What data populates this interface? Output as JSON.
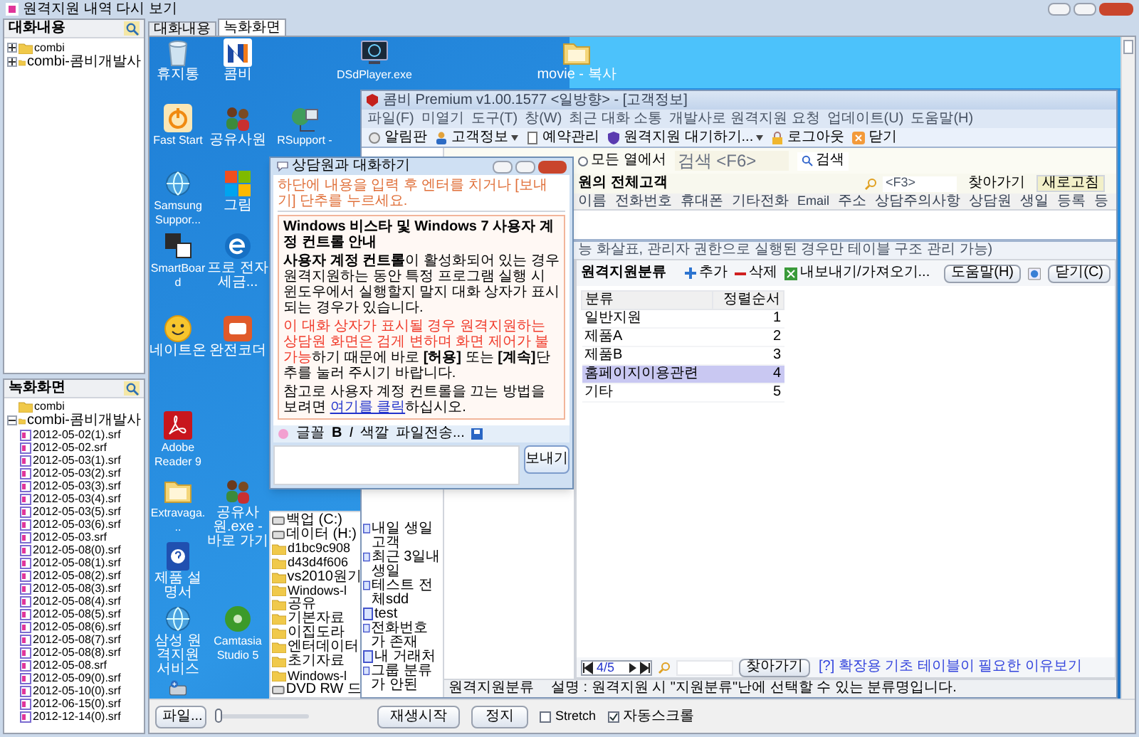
{
  "window": {
    "title": "원격지원 내역 다시 보기"
  },
  "sidebar": {
    "chat_panel": {
      "title": "대화내용",
      "tree": [
        {
          "label": "combi",
          "expanded": false
        },
        {
          "label": "combi-콤비개발사",
          "expanded": false
        }
      ]
    },
    "recording_panel": {
      "title": "녹화화면",
      "tree": [
        {
          "label": "combi"
        },
        {
          "label": "combi-콤비개발사",
          "expanded": true,
          "children": [
            {
              "label": "2012-05-02(1).srf"
            },
            {
              "label": "2012-05-02.srf"
            },
            {
              "label": "2012-05-03(1).srf"
            },
            {
              "label": "2012-05-03(2).srf"
            },
            {
              "label": "2012-05-03(3).srf"
            },
            {
              "label": "2012-05-03(4).srf"
            },
            {
              "label": "2012-05-03(5).srf"
            },
            {
              "label": "2012-05-03(6).srf"
            },
            {
              "label": "2012-05-03.srf"
            },
            {
              "label": "2012-05-08(0).srf"
            },
            {
              "label": "2012-05-08(1).srf"
            },
            {
              "label": "2012-05-08(2).srf"
            },
            {
              "label": "2012-05-08(3).srf"
            },
            {
              "label": "2012-05-08(4).srf"
            },
            {
              "label": "2012-05-08(5).srf"
            },
            {
              "label": "2012-05-08(6).srf"
            },
            {
              "label": "2012-05-08(7).srf"
            },
            {
              "label": "2012-05-08(8).srf"
            },
            {
              "label": "2012-05-08.srf"
            },
            {
              "label": "2012-05-09(0).srf"
            },
            {
              "label": "2012-05-10(0).srf"
            },
            {
              "label": "2012-06-15(0).srf"
            },
            {
              "label": "2012-12-14(0).srf"
            }
          ]
        }
      ]
    }
  },
  "tabs": [
    {
      "label": "대화내용",
      "selected": false
    },
    {
      "label": "녹화화면",
      "selected": true
    }
  ],
  "desktop": {
    "icons": [
      {
        "label": "휴지통",
        "kind": "trash"
      },
      {
        "label": "콤비",
        "kind": "logo"
      },
      {
        "label": "DSdPlayer.exe",
        "kind": "monitor"
      },
      {
        "label": "movie - 복사",
        "kind": "folder"
      },
      {
        "label": "Fast Start",
        "kind": "power"
      },
      {
        "label": "공유사원",
        "kind": "people"
      },
      {
        "label": "RSupport -",
        "kind": "network"
      },
      {
        "label": "Samsung Suppor...",
        "kind": "globe"
      },
      {
        "label": "그림",
        "kind": "tiles"
      },
      {
        "label": "SmartBoard",
        "kind": "board"
      },
      {
        "label": "프로 전자세금...",
        "kind": "browser"
      },
      {
        "label": "네이트온",
        "kind": "chat"
      },
      {
        "label": "완전코더",
        "kind": "app"
      },
      {
        "label": "Adobe Reader 9",
        "kind": "pdf"
      },
      {
        "label": "Extravaga...",
        "kind": "folder"
      },
      {
        "label": "공유사원.exe - 바로 가기",
        "kind": "people"
      },
      {
        "label": "제품 설명서",
        "kind": "help"
      },
      {
        "label": "삼성 원격지원 서비스",
        "kind": "globe"
      },
      {
        "label": "Camtasia Studio 5",
        "kind": "disc"
      },
      {
        "kind": "drive"
      }
    ]
  },
  "explorer": {
    "items": [
      {
        "label": "백업 (C:)",
        "kind": "drive"
      },
      {
        "label": "데이터 (H:)",
        "kind": "drive"
      },
      {
        "label": "d1bc9c908",
        "kind": "folder"
      },
      {
        "label": "d43d4f606",
        "kind": "folder"
      },
      {
        "label": "vs2010원기",
        "kind": "folder"
      },
      {
        "label": "Windows-l",
        "kind": "folder"
      },
      {
        "label": "공유",
        "kind": "folder"
      },
      {
        "label": "기본자료",
        "kind": "folder"
      },
      {
        "label": "이집도라",
        "kind": "folder"
      },
      {
        "label": "엔터데이터",
        "kind": "folder"
      },
      {
        "label": "초기자료",
        "kind": "folder"
      },
      {
        "label": "Windows-l",
        "kind": "folder"
      },
      {
        "label": "DVD RW 드",
        "kind": "drive"
      }
    ]
  },
  "app_window": {
    "title": "콤비 Premium v1.00.1577 <일방향> - [고객정보]",
    "menu": [
      "파일(F)",
      "미열기",
      "도구(T)",
      "창(W)",
      "최근 대화 소통",
      "개발사로 원격지원 요청",
      "업데이트(U)",
      "도움말(H)"
    ],
    "toolbar": [
      {
        "label": "알림판",
        "kind": "bell",
        "dropdown": false
      },
      {
        "label": "고객정보",
        "kind": "person",
        "dropdown": true
      },
      {
        "label": "예약관리",
        "kind": "note",
        "dropdown": false
      },
      {
        "label": "원격지원 대기하기...",
        "kind": "shield",
        "dropdown": true
      },
      {
        "label": "로그아웃",
        "kind": "lock",
        "dropdown": false
      },
      {
        "label": "닫기",
        "kind": "close",
        "dropdown": false
      }
    ],
    "search": {
      "scope": "모든 열에서",
      "placeholder": "검색 <F6>",
      "button": "검색"
    },
    "list_title": "원의 전체고객",
    "find": {
      "placeholder": "<F3>",
      "button": "찾아가기",
      "refresh": "새로고침"
    },
    "columns": [
      "이름",
      "전화번호",
      "휴대폰",
      "기타전화",
      "Email",
      "주소",
      "상담주의사항",
      "상담원",
      "생일",
      "등록",
      "등"
    ],
    "groups": [
      "내일 생일 고객",
      "최근 3일내 생일",
      "테스트 전체sdd",
      "test",
      "전화번호가 존재",
      "내 거래처",
      "그룹 분류가 안된"
    ],
    "panel_hint": "능 화살표, 관리자 권한으로 실행된 경우만 테이블 구조 관리 가능)",
    "category_panel": {
      "title": "원격지원분류",
      "add": "추가",
      "delete": "삭제",
      "export": "내보내기/가져오기...",
      "help": "도움말(H)",
      "close": "닫기(C)",
      "columns": [
        "분류",
        "정렬순서"
      ],
      "rows": [
        {
          "name": "일반지원",
          "order": "1",
          "selected": false
        },
        {
          "name": "제품A",
          "order": "2",
          "selected": false
        },
        {
          "name": "제품B",
          "order": "3",
          "selected": false
        },
        {
          "name": "홈페이지이용관련",
          "order": "4",
          "selected": true
        },
        {
          "name": "기타",
          "order": "5",
          "selected": false
        }
      ],
      "pager": "4/5",
      "find_button": "찾아가기",
      "help_link": "[?] 확장용 기초 테이블이 필요한 이유보기"
    },
    "status": [
      "원격지원분류",
      "설명 : 원격지원 시 \"지원분류\"난에 선택할 수 있는 분류명입니다."
    ]
  },
  "chat_dialog": {
    "title": "상담원과 대화하기",
    "instruction": "하단에 내용을 입력 후 엔터를 치거나 [보내기] 단추를 누르세요.",
    "notice_title": "Windows 비스타 및 Windows 7 사용자 계정 컨트롤 안내",
    "paragraphs": [
      {
        "kind": "plain",
        "text": "**사용자 계정 컨트롤**이 활성화되어 있는 경우 원격지원하는 동안 특정 프로그램 실행 시 윈도우에서 실행할지 말지 대화 상자가 표시되는 경우가 있습니다."
      },
      {
        "kind": "warning",
        "red_text": "이 대화 상자가 표시될 경우 원격지원하는 상담원 화면은 검게 변하며 화면 제어가 불가능",
        "text": "하기 때문에 바로 **[허용]** 또는 **[계속]**단추를 눌러 주시기 바랍니다."
      },
      {
        "kind": "link",
        "before": "참고로 사용자 계정 컨트롤을 끄는 방법을 보려면 ",
        "link": "여기를 클릭",
        "after": "하십시오."
      }
    ],
    "format_toolbar": [
      "글꼴",
      "B",
      "I",
      "색깔",
      "파일전송..."
    ],
    "send": "보내기"
  },
  "controls": {
    "file": "파일...",
    "level": 0,
    "play": "재생시작",
    "stop": "정지",
    "checkboxes": [
      {
        "label": "Stretch",
        "checked": false
      },
      {
        "label": "자동스크롤",
        "checked": true
      }
    ]
  }
}
